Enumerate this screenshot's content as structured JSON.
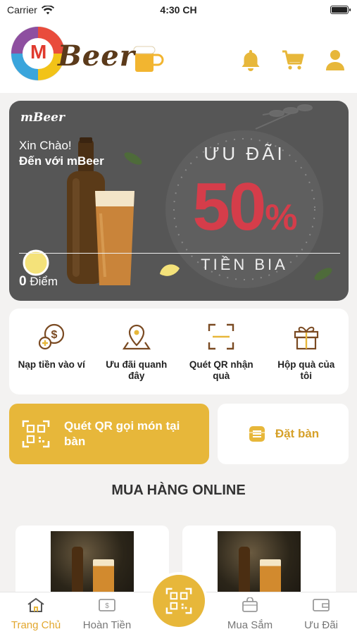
{
  "status_bar": {
    "carrier": "Carrier",
    "time": "4:30 CH"
  },
  "header": {
    "brand_letter": "M",
    "brand_text": "Beer",
    "icons": [
      "bell-icon",
      "cart-icon",
      "user-icon"
    ]
  },
  "banner": {
    "mini_logo": "mBeer",
    "greeting": "Xin Chào!",
    "welcome": "Đến với mBeer",
    "points_value": "0",
    "points_label": "Điểm",
    "promo_top": "ƯU ĐÃI",
    "promo_value": "50",
    "promo_unit": "%",
    "promo_bottom": "TIỀN BIA"
  },
  "actions": [
    {
      "label": "Nạp tiền vào ví",
      "icon": "wallet-topup-icon"
    },
    {
      "label": "Ưu đãi quanh đây",
      "icon": "map-pin-icon"
    },
    {
      "label": "Quét QR nhận quà",
      "icon": "qr-scan-icon"
    },
    {
      "label": "Hộp quà của tôi",
      "icon": "gift-icon"
    }
  ],
  "qr_order_label": "Quét QR gọi món tại bàn",
  "book_table_label": "Đặt bàn",
  "section_title": "MUA HÀNG ONLINE",
  "tabs": [
    {
      "label": "Trang Chủ",
      "icon": "home-icon",
      "active": true
    },
    {
      "label": "Hoàn Tiền",
      "icon": "cashback-icon",
      "active": false
    },
    {
      "label": "Mua Sắm",
      "icon": "shopping-bag-icon",
      "active": false
    },
    {
      "label": "Ưu Đãi",
      "icon": "wallet-icon",
      "active": false
    }
  ],
  "colors": {
    "accent": "#e7b73a",
    "promo_red": "#d53d4a",
    "banner_bg": "#565656",
    "brand_brown": "#5b3a1a"
  }
}
